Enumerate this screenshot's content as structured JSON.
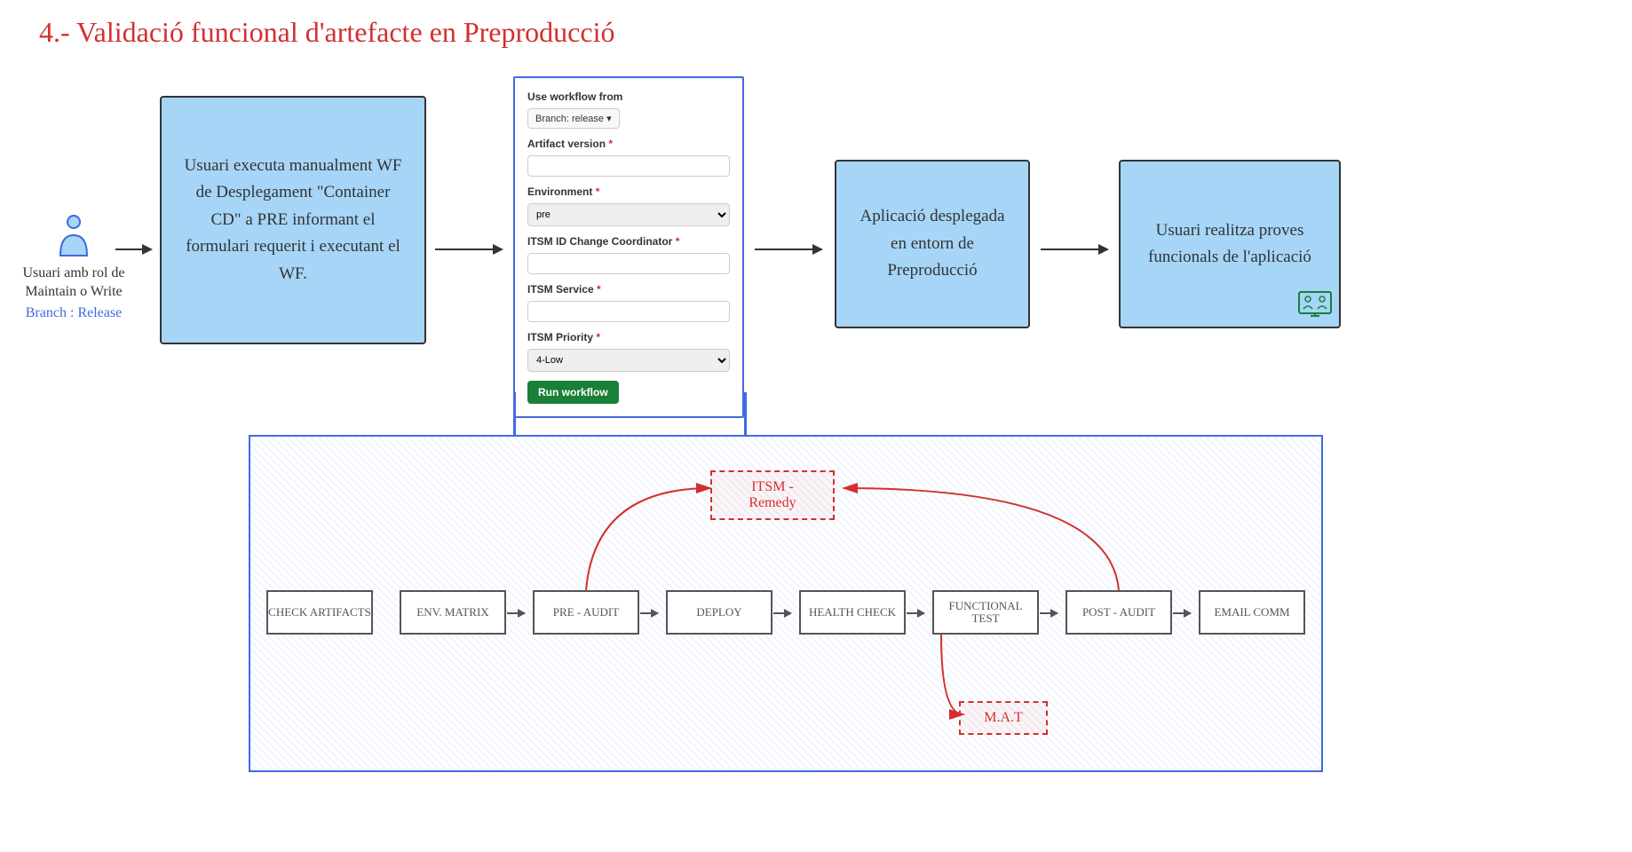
{
  "title": "4.- Validació funcional d'artefacte en Preproducció",
  "actor": {
    "label": "Usuari amb rol de Maintain o Write",
    "branch": "Branch : Release"
  },
  "boxes": {
    "step1": "Usuari executa manualment WF de Desplegament \"Container CD\" a PRE informant el formulari requerit i executant el WF.",
    "step4": "Aplicació desplegada en entorn de Preproducció",
    "step5": "Usuari realitza proves funcionals de l'aplicació"
  },
  "form": {
    "workflow_from_label": "Use workflow from",
    "branch_label": "Branch: release",
    "artifact_label": "Artifact version",
    "env_label": "Environment",
    "env_value": "pre",
    "itsm_id_label": "ITSM ID Change Coordinator",
    "itsm_service_label": "ITSM Service",
    "itsm_priority_label": "ITSM Priority",
    "itsm_priority_value": "4-Low",
    "run_button": "Run workflow"
  },
  "pipeline": {
    "s1": "CHECK ARTIFACTS",
    "s2": "ENV. MATRIX",
    "s3": "PRE - AUDIT",
    "s4": "DEPLOY",
    "s5": "HEALTH CHECK",
    "s6": "FUNCTIONAL TEST",
    "s7": "POST - AUDIT",
    "s8": "EMAIL COMM"
  },
  "callouts": {
    "itsm": "ITSM - Remedy",
    "mat": "M.A.T"
  }
}
